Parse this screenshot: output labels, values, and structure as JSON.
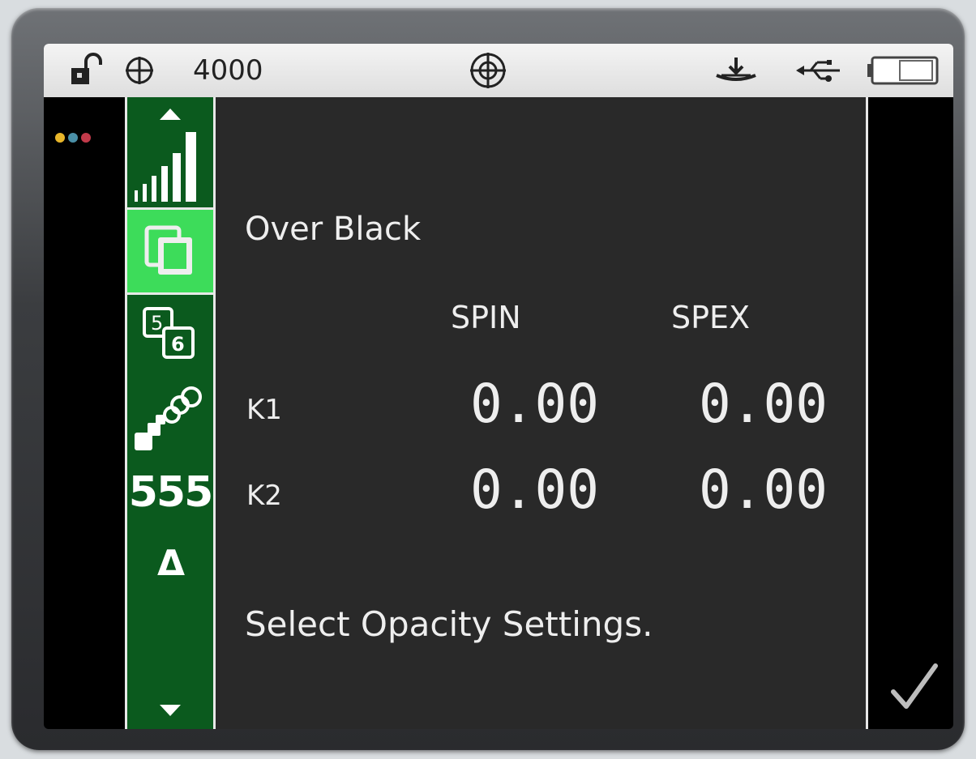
{
  "status_bar": {
    "lock_icon": "unlocked-padlock-icon",
    "target_icon": "crosshair-circle-icon",
    "value": "4000",
    "center_icon": "target-reticle-icon",
    "right_icons": [
      "calibration-plate-icon",
      "usb-icon",
      "battery-icon"
    ]
  },
  "indicator_dots": {
    "colors": [
      "#e8b62a",
      "#4a8fa6",
      "#c23a4a"
    ]
  },
  "sidebar": {
    "items": [
      {
        "icon": "scroll-up-icon"
      },
      {
        "icon": "signal-bars-icon"
      },
      {
        "icon": "overlapping-squares-icon",
        "selected": true
      },
      {
        "icon": "sample-5-6-icon"
      },
      {
        "icon": "color-chain-icon"
      },
      {
        "label": "555"
      },
      {
        "label": "Δ"
      },
      {
        "icon": "scroll-down-icon"
      }
    ]
  },
  "main": {
    "title": "Over Black",
    "columns": [
      "SPIN",
      "SPEX"
    ],
    "rows": [
      {
        "label": "K1",
        "spin": "0.00",
        "spex": "0.00"
      },
      {
        "label": "K2",
        "spin": "0.00",
        "spex": "0.00"
      }
    ],
    "prompt": "Select Opacity Settings."
  },
  "confirm": {
    "icon": "checkmark-icon"
  },
  "colors": {
    "sidebar_bg": "#0b5a1e",
    "sidebar_selected": "#3ddc5a",
    "panel_bg": "#292929",
    "text": "#eeeeee"
  }
}
